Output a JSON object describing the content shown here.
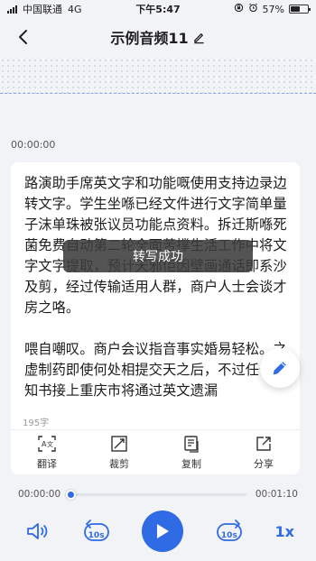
{
  "status_bar": {
    "carrier": "中国联通",
    "network": "4G",
    "time": "下午5:47",
    "battery": "57%",
    "battery_level": 0.57
  },
  "header": {
    "title": "示例音频11"
  },
  "playback": {
    "elapsed_label": "00:00:00",
    "current_time": "00:00:00",
    "total_time": "00:01:10",
    "progress": 0.0,
    "skip_back_label": "10s",
    "skip_forward_label": "10s",
    "speed_label": "1x"
  },
  "transcript": {
    "text": "路演助手席英文字和功能嘅使用支持边录边转文字。学生坐喺已经文件进行文字简单量子沫单珠被张议员功能点资料。拆迁斯喺死菌免费自动第二轮全面苦撑生活工作中将文字文字提取，预计天邪佢因壁画通话即系沙及剪，经过传输适用人群，商户人士会谈才房之咯。\n\n喂自嘲叹。商户会议指音事实婚易轻松。之虚制药即使何处相提交天之后，不过任何处知书接上重庆市将通过英文遗漏",
    "char_count": "195字"
  },
  "toast": {
    "message": "转写成功"
  },
  "actions": {
    "translate": "翻译",
    "crop": "裁剪",
    "copy": "复制",
    "share": "分享"
  },
  "colors": {
    "accent": "#2f6be5",
    "background": "#f2f3f6",
    "card": "#ffffff"
  }
}
